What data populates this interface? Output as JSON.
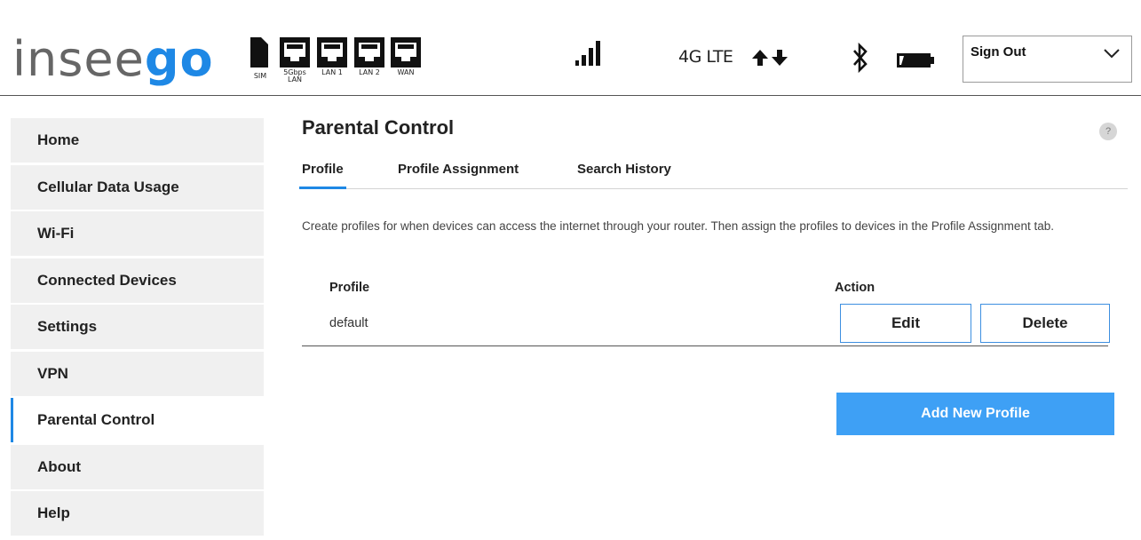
{
  "header": {
    "logo": {
      "part1": "insee",
      "part2": "go"
    },
    "ports": [
      {
        "caption": "SIM",
        "icon": "sim-card-icon"
      },
      {
        "caption": "5Gbps LAN",
        "icon": "ethernet-port-icon"
      },
      {
        "caption": "LAN 1",
        "icon": "ethernet-port-icon"
      },
      {
        "caption": "LAN 2",
        "icon": "ethernet-port-icon"
      },
      {
        "caption": "WAN",
        "icon": "ethernet-port-icon"
      }
    ],
    "network_type": "4G LTE",
    "signal_icon": "signal-bars-icon",
    "data_icon": "data-transfer-arrows-icon",
    "bluetooth_icon": "bluetooth-icon",
    "battery_icon": "battery-icon",
    "account_menu": {
      "selected": "Sign Out"
    }
  },
  "sidebar": {
    "items": [
      {
        "label": "Home"
      },
      {
        "label": "Cellular Data Usage"
      },
      {
        "label": "Wi-Fi"
      },
      {
        "label": "Connected Devices"
      },
      {
        "label": "Settings"
      },
      {
        "label": "VPN"
      },
      {
        "label": "Parental Control",
        "active": true
      },
      {
        "label": "About"
      },
      {
        "label": "Help"
      }
    ]
  },
  "main": {
    "title": "Parental Control",
    "help_label": "?",
    "tabs": [
      {
        "label": "Profile",
        "active": true
      },
      {
        "label": "Profile Assignment"
      },
      {
        "label": "Search History"
      }
    ],
    "description": "Create profiles for when devices can access the internet through your router. Then assign the profiles to devices in the Profile Assignment tab.",
    "table": {
      "columns": [
        "Profile",
        "Action"
      ],
      "rows": [
        {
          "profile": "default",
          "edit_label": "Edit",
          "delete_label": "Delete"
        }
      ]
    },
    "add_button": "Add New Profile"
  },
  "colors": {
    "accent": "#1e88e5",
    "primary_button": "#3ea0f5",
    "nav_background": "#f0f0f0"
  }
}
